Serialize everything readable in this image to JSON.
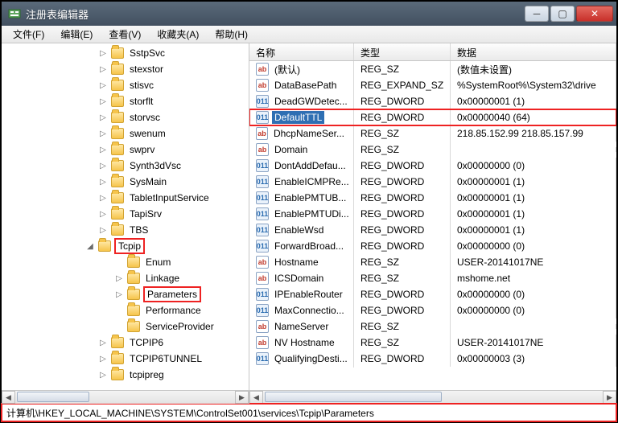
{
  "window": {
    "title": "注册表编辑器"
  },
  "menus": {
    "file": "文件(F)",
    "edit": "编辑(E)",
    "view": "查看(V)",
    "favorites": "收藏夹(A)",
    "help": "帮助(H)"
  },
  "tree": {
    "indent_base": 120,
    "items": [
      {
        "label": "SstpSvc",
        "exp": "▷",
        "boxed": false
      },
      {
        "label": "stexstor",
        "exp": "▷",
        "boxed": false
      },
      {
        "label": "stisvc",
        "exp": "▷",
        "boxed": false
      },
      {
        "label": "storflt",
        "exp": "▷",
        "boxed": false
      },
      {
        "label": "storvsc",
        "exp": "▷",
        "boxed": false
      },
      {
        "label": "swenum",
        "exp": "▷",
        "boxed": false
      },
      {
        "label": "swprv",
        "exp": "▷",
        "boxed": false
      },
      {
        "label": "Synth3dVsc",
        "exp": "▷",
        "boxed": false
      },
      {
        "label": "SysMain",
        "exp": "▷",
        "boxed": false
      },
      {
        "label": "TabletInputService",
        "exp": "▷",
        "boxed": false
      },
      {
        "label": "TapiSrv",
        "exp": "▷",
        "boxed": false
      },
      {
        "label": "TBS",
        "exp": "▷",
        "boxed": false
      },
      {
        "label": "Tcpip",
        "exp": "◢",
        "boxed": true,
        "indent": -16
      },
      {
        "label": "Enum",
        "exp": "",
        "boxed": false,
        "indent": 20
      },
      {
        "label": "Linkage",
        "exp": "▷",
        "boxed": false,
        "indent": 20
      },
      {
        "label": "Parameters",
        "exp": "▷",
        "boxed": true,
        "indent": 20
      },
      {
        "label": "Performance",
        "exp": "",
        "boxed": false,
        "indent": 20
      },
      {
        "label": "ServiceProvider",
        "exp": "",
        "boxed": false,
        "indent": 20
      },
      {
        "label": "TCPIP6",
        "exp": "▷",
        "boxed": false
      },
      {
        "label": "TCPIP6TUNNEL",
        "exp": "▷",
        "boxed": false
      },
      {
        "label": "tcpipreg",
        "exp": "▷",
        "boxed": false
      }
    ]
  },
  "list": {
    "headers": {
      "name": "名称",
      "type": "类型",
      "data": "数据"
    },
    "rows": [
      {
        "icon": "sz",
        "name": "(默认)",
        "type": "REG_SZ",
        "data": "(数值未设置)"
      },
      {
        "icon": "sz",
        "name": "DataBasePath",
        "type": "REG_EXPAND_SZ",
        "data": "%SystemRoot%\\System32\\drive"
      },
      {
        "icon": "dw",
        "name": "DeadGWDetec...",
        "type": "REG_DWORD",
        "data": "0x00000001 (1)"
      },
      {
        "icon": "dw",
        "name": "DefaultTTL",
        "type": "REG_DWORD",
        "data": "0x00000040 (64)",
        "selected": true,
        "box": true
      },
      {
        "icon": "sz",
        "name": "DhcpNameSer...",
        "type": "REG_SZ",
        "data": "218.85.152.99 218.85.157.99"
      },
      {
        "icon": "sz",
        "name": "Domain",
        "type": "REG_SZ",
        "data": ""
      },
      {
        "icon": "dw",
        "name": "DontAddDefau...",
        "type": "REG_DWORD",
        "data": "0x00000000 (0)"
      },
      {
        "icon": "dw",
        "name": "EnableICMPRe...",
        "type": "REG_DWORD",
        "data": "0x00000001 (1)"
      },
      {
        "icon": "dw",
        "name": "EnablePMTUB...",
        "type": "REG_DWORD",
        "data": "0x00000001 (1)"
      },
      {
        "icon": "dw",
        "name": "EnablePMTUDi...",
        "type": "REG_DWORD",
        "data": "0x00000001 (1)"
      },
      {
        "icon": "dw",
        "name": "EnableWsd",
        "type": "REG_DWORD",
        "data": "0x00000001 (1)"
      },
      {
        "icon": "dw",
        "name": "ForwardBroad...",
        "type": "REG_DWORD",
        "data": "0x00000000 (0)"
      },
      {
        "icon": "sz",
        "name": "Hostname",
        "type": "REG_SZ",
        "data": "USER-20141017NE"
      },
      {
        "icon": "sz",
        "name": "ICSDomain",
        "type": "REG_SZ",
        "data": "mshome.net"
      },
      {
        "icon": "dw",
        "name": "IPEnableRouter",
        "type": "REG_DWORD",
        "data": "0x00000000 (0)"
      },
      {
        "icon": "dw",
        "name": "MaxConnectio...",
        "type": "REG_DWORD",
        "data": "0x00000000 (0)"
      },
      {
        "icon": "sz",
        "name": "NameServer",
        "type": "REG_SZ",
        "data": ""
      },
      {
        "icon": "sz",
        "name": "NV Hostname",
        "type": "REG_SZ",
        "data": "USER-20141017NE"
      },
      {
        "icon": "dw",
        "name": "QualifyingDesti...",
        "type": "REG_DWORD",
        "data": "0x00000003 (3)"
      }
    ]
  },
  "status": {
    "path": "计算机\\HKEY_LOCAL_MACHINE\\SYSTEM\\ControlSet001\\services\\Tcpip\\Parameters"
  }
}
